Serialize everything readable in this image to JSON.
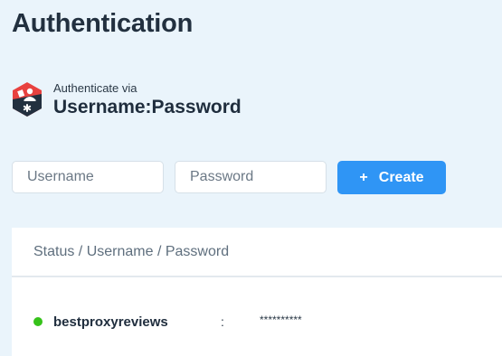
{
  "page": {
    "title": "Authentication"
  },
  "auth_method": {
    "subtitle": "Authenticate via",
    "method": "Username:Password",
    "icon": "user-key-hexagon-icon",
    "icon_colors": {
      "top": "#e8413f",
      "bottom": "#22303f"
    }
  },
  "form": {
    "username_placeholder": "Username",
    "password_placeholder": "Password",
    "create_label": "Create",
    "create_icon": "+",
    "accent_color": "#2f95f5"
  },
  "table": {
    "header": "Status / Username / Password",
    "rows": [
      {
        "status": "active",
        "status_color": "#36c21a",
        "username": "bestproxyreviews",
        "separator": ":",
        "password": "**********"
      }
    ]
  }
}
